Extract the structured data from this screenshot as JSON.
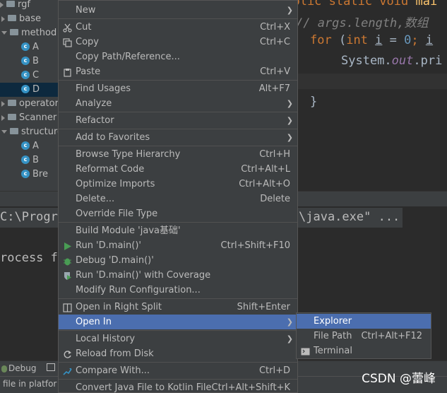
{
  "project_tree": [
    {
      "label": "rgf",
      "kind": "folder",
      "indent": 0
    },
    {
      "label": "base",
      "kind": "folder",
      "indent": 1
    },
    {
      "label": "method",
      "kind": "folder",
      "indent": 1,
      "expanded": true
    },
    {
      "label": "A",
      "kind": "class",
      "indent": 2
    },
    {
      "label": "B",
      "kind": "class",
      "indent": 2
    },
    {
      "label": "C",
      "kind": "class",
      "indent": 2
    },
    {
      "label": "D",
      "kind": "class",
      "indent": 2,
      "selected": true
    },
    {
      "label": "operator",
      "kind": "folder",
      "indent": 1
    },
    {
      "label": "Scanner",
      "kind": "folder",
      "indent": 1
    },
    {
      "label": "structure",
      "kind": "folder",
      "indent": 1,
      "expanded": true
    },
    {
      "label": "A",
      "kind": "class",
      "indent": 2
    },
    {
      "label": "B",
      "kind": "class",
      "indent": 2
    },
    {
      "label": "Bre",
      "kind": "class",
      "indent": 2
    }
  ],
  "editor": {
    "line1": {
      "kw": "public static void ",
      "rest": "mai"
    },
    "line2": {
      "comment": "//  args.length,数组"
    },
    "line3": {
      "kw": "for ",
      "p1": "(",
      "kw2": "int ",
      "var": "i",
      "p2": " = ",
      "num": "0",
      "p3": "; ",
      "var2": "i"
    },
    "line4": {
      "cls": "System.",
      "fld": "out",
      "rest": ".pri"
    },
    "line5": {
      "brace": "}"
    }
  },
  "run_panel": {
    "command_prefix": "C:\\Progr",
    "command_suffix": "\\java.exe\" ...",
    "process_text": "rocess f"
  },
  "bottom_toolbar": {
    "debug_label": "Debug"
  },
  "status_bar": {
    "text": "file in platfor"
  },
  "context_menu": [
    {
      "label": "New",
      "shortcut": "",
      "submenu": true
    },
    {
      "sep": true
    },
    {
      "label": "Cut",
      "shortcut": "Ctrl+X",
      "icon": "scissors-icon"
    },
    {
      "label": "Copy",
      "shortcut": "Ctrl+C",
      "icon": "copy-icon"
    },
    {
      "label": "Copy Path/Reference...",
      "shortcut": ""
    },
    {
      "label": "Paste",
      "shortcut": "Ctrl+V",
      "icon": "clipboard-icon"
    },
    {
      "sep": true
    },
    {
      "label": "Find Usages",
      "shortcut": "Alt+F7"
    },
    {
      "label": "Analyze",
      "shortcut": "",
      "submenu": true
    },
    {
      "sep": true
    },
    {
      "label": "Refactor",
      "shortcut": "",
      "submenu": true
    },
    {
      "sep": true
    },
    {
      "label": "Add to Favorites",
      "shortcut": "",
      "submenu": true
    },
    {
      "sep": true
    },
    {
      "label": "Browse Type Hierarchy",
      "shortcut": "Ctrl+H"
    },
    {
      "label": "Reformat Code",
      "shortcut": "Ctrl+Alt+L"
    },
    {
      "label": "Optimize Imports",
      "shortcut": "Ctrl+Alt+O"
    },
    {
      "label": "Delete...",
      "shortcut": "Delete"
    },
    {
      "label": "Override File Type",
      "shortcut": ""
    },
    {
      "sep": true
    },
    {
      "label": "Build Module 'java基础'",
      "shortcut": ""
    },
    {
      "label": "Run 'D.main()'",
      "shortcut": "Ctrl+Shift+F10",
      "icon": "run-icon"
    },
    {
      "label": "Debug 'D.main()'",
      "shortcut": "",
      "icon": "debug-icon"
    },
    {
      "label": "Run 'D.main()' with Coverage",
      "shortcut": "",
      "icon": "coverage-icon"
    },
    {
      "label": "Modify Run Configuration...",
      "shortcut": ""
    },
    {
      "sep": true
    },
    {
      "label": "Open in Right Split",
      "shortcut": "Shift+Enter",
      "icon": "split-icon"
    },
    {
      "label": "Open In",
      "shortcut": "",
      "submenu": true,
      "active": true
    },
    {
      "sep": true
    },
    {
      "label": "Local History",
      "shortcut": "",
      "submenu": true
    },
    {
      "label": "Reload from Disk",
      "shortcut": "",
      "icon": "reload-icon"
    },
    {
      "sep": true
    },
    {
      "label": "Compare With...",
      "shortcut": "Ctrl+D",
      "icon": "compare-icon"
    },
    {
      "sep": true
    },
    {
      "label": "Convert Java File to Kotlin File",
      "shortcut": "Ctrl+Alt+Shift+K"
    }
  ],
  "submenu": [
    {
      "label": "Explorer",
      "shortcut": "",
      "active": true
    },
    {
      "label": "File Path",
      "shortcut": "Ctrl+Alt+F12"
    },
    {
      "label": "Terminal",
      "shortcut": "",
      "icon": "terminal-icon"
    }
  ],
  "watermark": "CSDN @蕾峰",
  "colors": {
    "menu_bg": "#3c3f41",
    "highlight": "#4b6eaf",
    "keyword": "#cc7832",
    "number": "#6897bb",
    "field": "#9876aa",
    "comment": "#808080"
  }
}
